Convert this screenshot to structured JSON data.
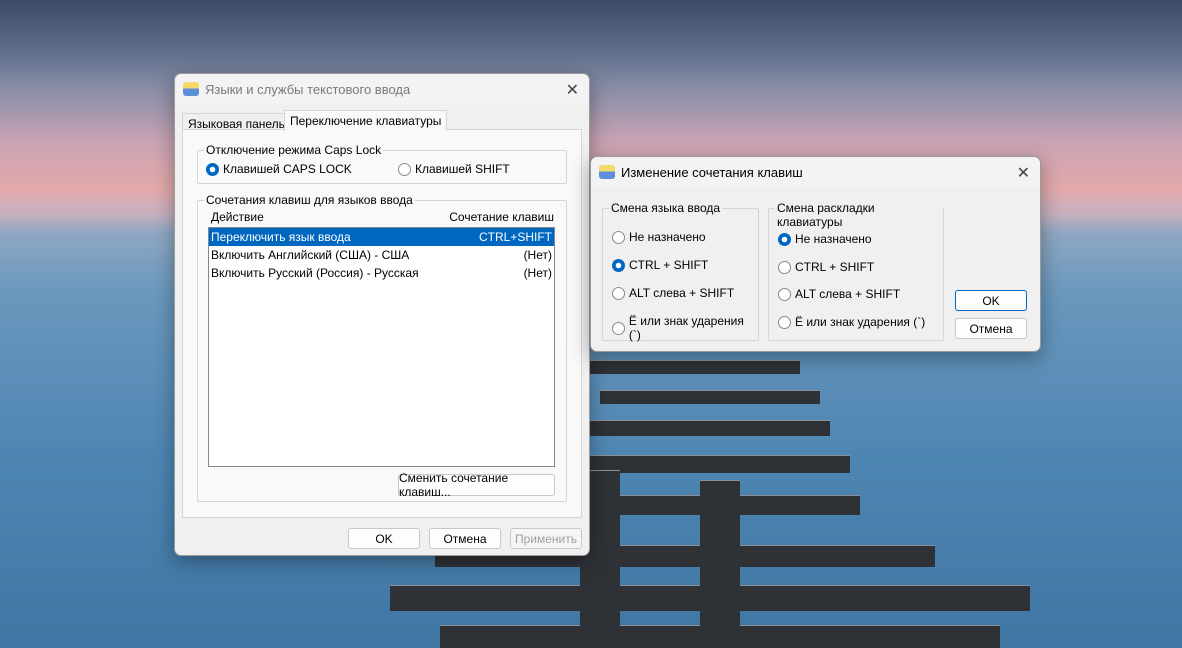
{
  "main_dialog": {
    "title": "Языки и службы текстового ввода",
    "tabs": [
      {
        "label": "Языковая панель"
      },
      {
        "label": "Переключение клавиатуры"
      }
    ],
    "caps_group": {
      "legend": "Отключение режима Caps Lock",
      "options": [
        {
          "label": "Клавишей CAPS LOCK",
          "selected": true
        },
        {
          "label": "Клавишей SHIFT",
          "selected": false
        }
      ]
    },
    "hotkeys_group": {
      "legend": "Сочетания клавиш для языков ввода",
      "columns": [
        "Действие",
        "Сочетание клавиш"
      ],
      "rows": [
        {
          "action": "Переключить язык ввода",
          "keys": "CTRL+SHIFT",
          "selected": true
        },
        {
          "action": "Включить Английский (США) - США",
          "keys": "(Нет)"
        },
        {
          "action": "Включить Русский (Россия) - Русская",
          "keys": "(Нет)"
        }
      ],
      "change_button": "Сменить сочетание клавиш..."
    },
    "buttons": {
      "ok": "OK",
      "cancel": "Отмена",
      "apply": "Применить"
    }
  },
  "change_dialog": {
    "title": "Изменение сочетания клавиш",
    "input_language": {
      "legend": "Смена языка ввода",
      "options": [
        {
          "label": "Не назначено",
          "selected": false
        },
        {
          "label": "CTRL + SHIFT",
          "selected": true
        },
        {
          "label": "ALT слева + SHIFT",
          "selected": false
        },
        {
          "label": "Ё или знак ударения (`)",
          "selected": false
        }
      ]
    },
    "layout": {
      "legend": "Смена раскладки клавиатуры",
      "options": [
        {
          "label": "Не назначено",
          "selected": true
        },
        {
          "label": "CTRL + SHIFT",
          "selected": false
        },
        {
          "label": "ALT слева + SHIFT",
          "selected": false
        },
        {
          "label": "Ё или знак ударения (`)",
          "selected": false
        }
      ]
    },
    "buttons": {
      "ok": "OK",
      "cancel": "Отмена"
    }
  }
}
